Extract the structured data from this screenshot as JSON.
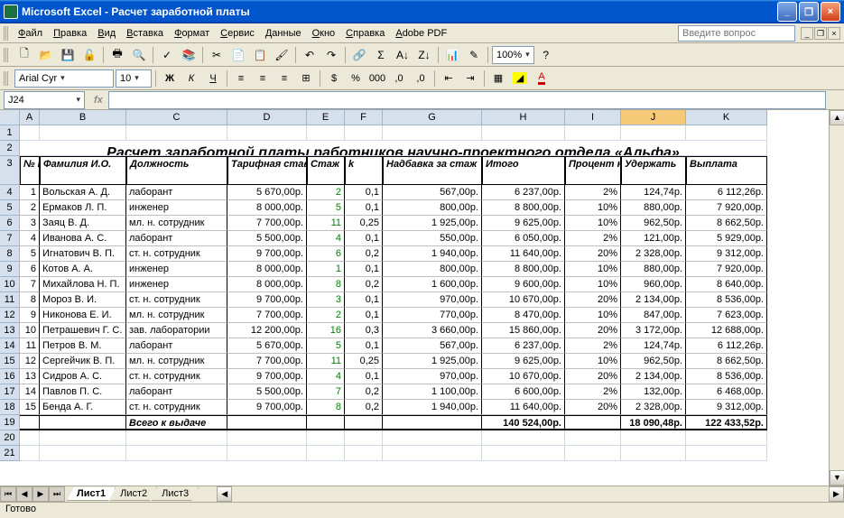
{
  "titlebar": {
    "app": "Microsoft Excel",
    "doc": "Расчет заработной платы"
  },
  "menus": [
    "Файл",
    "Правка",
    "Вид",
    "Вставка",
    "Формат",
    "Сервис",
    "Данные",
    "Окно",
    "Справка",
    "Adobe PDF"
  ],
  "helpPlaceholder": "Введите вопрос",
  "font": {
    "name": "Arial Cyr",
    "size": "10"
  },
  "zoom": "100%",
  "namebox": "J24",
  "formula": "",
  "columns": [
    "A",
    "B",
    "C",
    "D",
    "E",
    "F",
    "G",
    "H",
    "I",
    "J",
    "K"
  ],
  "selectedCol": "J",
  "rowNums": [
    1,
    2,
    3,
    4,
    5,
    6,
    7,
    8,
    9,
    10,
    11,
    12,
    13,
    14,
    15,
    16,
    17,
    18,
    19,
    20,
    21
  ],
  "title": "Расчет заработной платы работников научно-проектного отдела «Альфа»",
  "headers": [
    "№\nпп",
    "Фамилия И.О.",
    "Должность",
    "Тарифная ставка",
    "Стаж",
    "k",
    "Надбавка за стаж",
    "Итого",
    "Процент налога",
    "Удержать",
    "Выплата"
  ],
  "rows": [
    [
      1,
      "Вольская А. Д.",
      "лаборант",
      "5 670,00р.",
      2,
      "0,1",
      "567,00р.",
      "6 237,00р.",
      "2%",
      "124,74р.",
      "6 112,26р."
    ],
    [
      2,
      "Ермаков Л. П.",
      "инженер",
      "8 000,00р.",
      5,
      "0,1",
      "800,00р.",
      "8 800,00р.",
      "10%",
      "880,00р.",
      "7 920,00р."
    ],
    [
      3,
      "Заяц В. Д.",
      "мл. н. сотрудник",
      "7 700,00р.",
      11,
      "0,25",
      "1 925,00р.",
      "9 625,00р.",
      "10%",
      "962,50р.",
      "8 662,50р."
    ],
    [
      4,
      "Иванова А. С.",
      "лаборант",
      "5 500,00р.",
      4,
      "0,1",
      "550,00р.",
      "6 050,00р.",
      "2%",
      "121,00р.",
      "5 929,00р."
    ],
    [
      5,
      "Игнатович В. П.",
      "ст. н. сотрудник",
      "9 700,00р.",
      6,
      "0,2",
      "1 940,00р.",
      "11 640,00р.",
      "20%",
      "2 328,00р.",
      "9 312,00р."
    ],
    [
      6,
      "Котов А. А.",
      "инженер",
      "8 000,00р.",
      1,
      "0,1",
      "800,00р.",
      "8 800,00р.",
      "10%",
      "880,00р.",
      "7 920,00р."
    ],
    [
      7,
      "Михайлова Н. П.",
      "инженер",
      "8 000,00р.",
      8,
      "0,2",
      "1 600,00р.",
      "9 600,00р.",
      "10%",
      "960,00р.",
      "8 640,00р."
    ],
    [
      8,
      "Мороз В. И.",
      "ст. н. сотрудник",
      "9 700,00р.",
      3,
      "0,1",
      "970,00р.",
      "10 670,00р.",
      "20%",
      "2 134,00р.",
      "8 536,00р."
    ],
    [
      9,
      "Никонова Е. И.",
      "мл. н. сотрудник",
      "7 700,00р.",
      2,
      "0,1",
      "770,00р.",
      "8 470,00р.",
      "10%",
      "847,00р.",
      "7 623,00р."
    ],
    [
      10,
      "Петрашевич Г. С.",
      "зав. лаборатории",
      "12 200,00р.",
      16,
      "0,3",
      "3 660,00р.",
      "15 860,00р.",
      "20%",
      "3 172,00р.",
      "12 688,00р."
    ],
    [
      11,
      "Петров В. М.",
      "лаборант",
      "5 670,00р.",
      5,
      "0,1",
      "567,00р.",
      "6 237,00р.",
      "2%",
      "124,74р.",
      "6 112,26р."
    ],
    [
      12,
      "Сергейчик В. П.",
      "мл. н. сотрудник",
      "7 700,00р.",
      11,
      "0,25",
      "1 925,00р.",
      "9 625,00р.",
      "10%",
      "962,50р.",
      "8 662,50р."
    ],
    [
      13,
      "Сидров А. С.",
      "ст. н. сотрудник",
      "9 700,00р.",
      4,
      "0,1",
      "970,00р.",
      "10 670,00р.",
      "20%",
      "2 134,00р.",
      "8 536,00р."
    ],
    [
      14,
      "Павлов П. С.",
      "лаборант",
      "5 500,00р.",
      7,
      "0,2",
      "1 100,00р.",
      "6 600,00р.",
      "2%",
      "132,00р.",
      "6 468,00р."
    ],
    [
      15,
      "Бенда А. Г.",
      "ст. н. сотрудник",
      "9 700,00р.",
      8,
      "0,2",
      "1 940,00р.",
      "11 640,00р.",
      "20%",
      "2 328,00р.",
      "9 312,00р."
    ]
  ],
  "totalsLabel": "Всего к выдаче",
  "totals": {
    "itogo": "140 524,00р.",
    "uderzh": "18 090,48р.",
    "vyplata": "122 433,52р."
  },
  "sheets": [
    "Лист1",
    "Лист2",
    "Лист3"
  ],
  "activeSheet": 0,
  "status": "Готово"
}
